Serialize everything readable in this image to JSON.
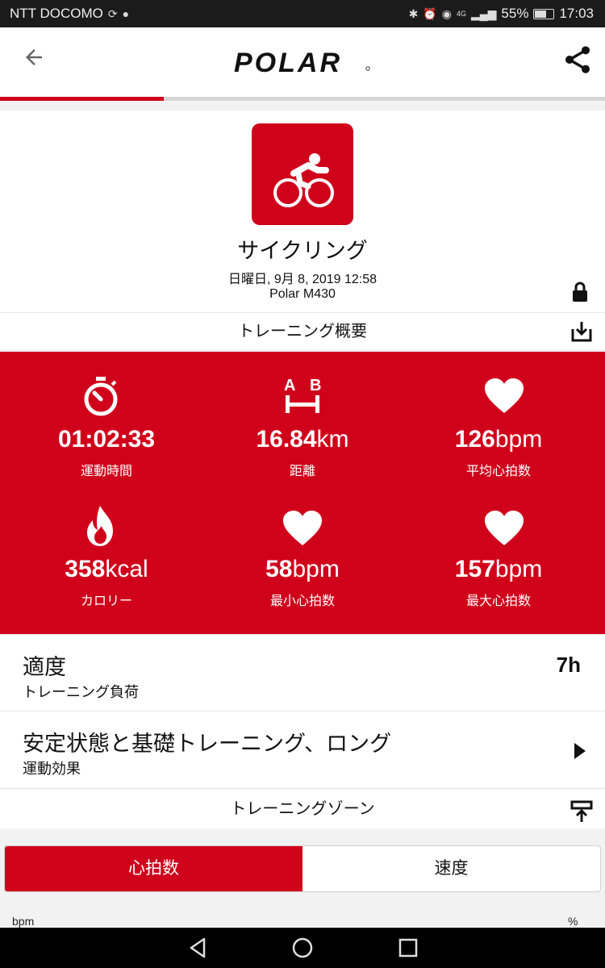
{
  "status_bar": {
    "carrier": "NTT DOCOMO",
    "battery": "55%",
    "time": "17:03",
    "network": "4G"
  },
  "header": {
    "logo_text": "POLAR",
    "back_icon": "arrow-back-icon",
    "share_icon": "share-icon"
  },
  "progress": {
    "fraction": 0.27
  },
  "session": {
    "sport": "サイクリング",
    "sport_icon": "cycling-icon",
    "datetime": "日曜日, 9月 8, 2019 12:58",
    "device": "Polar M430"
  },
  "overview": {
    "title": "トレーニング概要",
    "action_icon": "download-icon"
  },
  "stats": [
    {
      "icon": "stopwatch-icon",
      "value": "01:02:33",
      "unit": "",
      "label": "運動時間"
    },
    {
      "icon": "distance-icon",
      "value": "16.84",
      "unit": "km",
      "label": "距離"
    },
    {
      "icon": "heart-icon",
      "value": "126",
      "unit": "bpm",
      "label": "平均心拍数"
    },
    {
      "icon": "flame-icon",
      "value": "358",
      "unit": "kcal",
      "label": "カロリー"
    },
    {
      "icon": "heart-icon",
      "value": "58",
      "unit": "bpm",
      "label": "最小心拍数"
    },
    {
      "icon": "heart-icon",
      "value": "157",
      "unit": "bpm",
      "label": "最大心拍数"
    }
  ],
  "distance_icon_letters": {
    "a": "A",
    "b": "B"
  },
  "training_load": {
    "title": "適度",
    "subtitle": "トレーニング負荷",
    "value": "7h"
  },
  "training_benefit": {
    "title": "安定状態と基礎トレーニング、ロング",
    "subtitle": "運動効果"
  },
  "zones": {
    "title": "トレーニングゾーン",
    "action_icon": "upload-icon",
    "tabs": [
      "心拍数",
      "速度"
    ],
    "selected_tab": 0,
    "axis_left": "bpm",
    "axis_right": "%"
  },
  "colors": {
    "accent": "#d0021b"
  }
}
